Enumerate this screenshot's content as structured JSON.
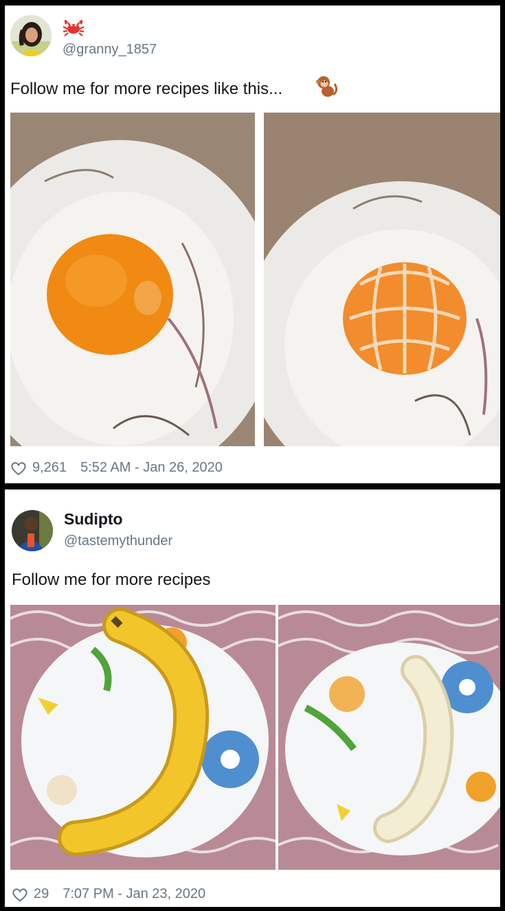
{
  "tweets": [
    {
      "display_name": "",
      "handle": "@granny_1857",
      "text": "Follow me for more recipes like this...",
      "likes": "9,261",
      "timestamp": "5:52 AM - Jan 26, 2020",
      "name_emoji": "crab-icon",
      "text_emoji": "monkey-icon",
      "photos": [
        "orange-on-plate",
        "peeled-orange-on-plate"
      ]
    },
    {
      "display_name": "Sudipto",
      "handle": "@tastemythunder",
      "text": "Follow me for more recipes",
      "likes": "29",
      "timestamp": "7:07 PM - Jan 23, 2020",
      "photos": [
        "banana-on-plate",
        "peeled-banana-on-plate"
      ]
    }
  ],
  "colors": {
    "handle": "#657786",
    "text": "#14171a",
    "orange": "#f08a12",
    "banana": "#f2c62a"
  }
}
